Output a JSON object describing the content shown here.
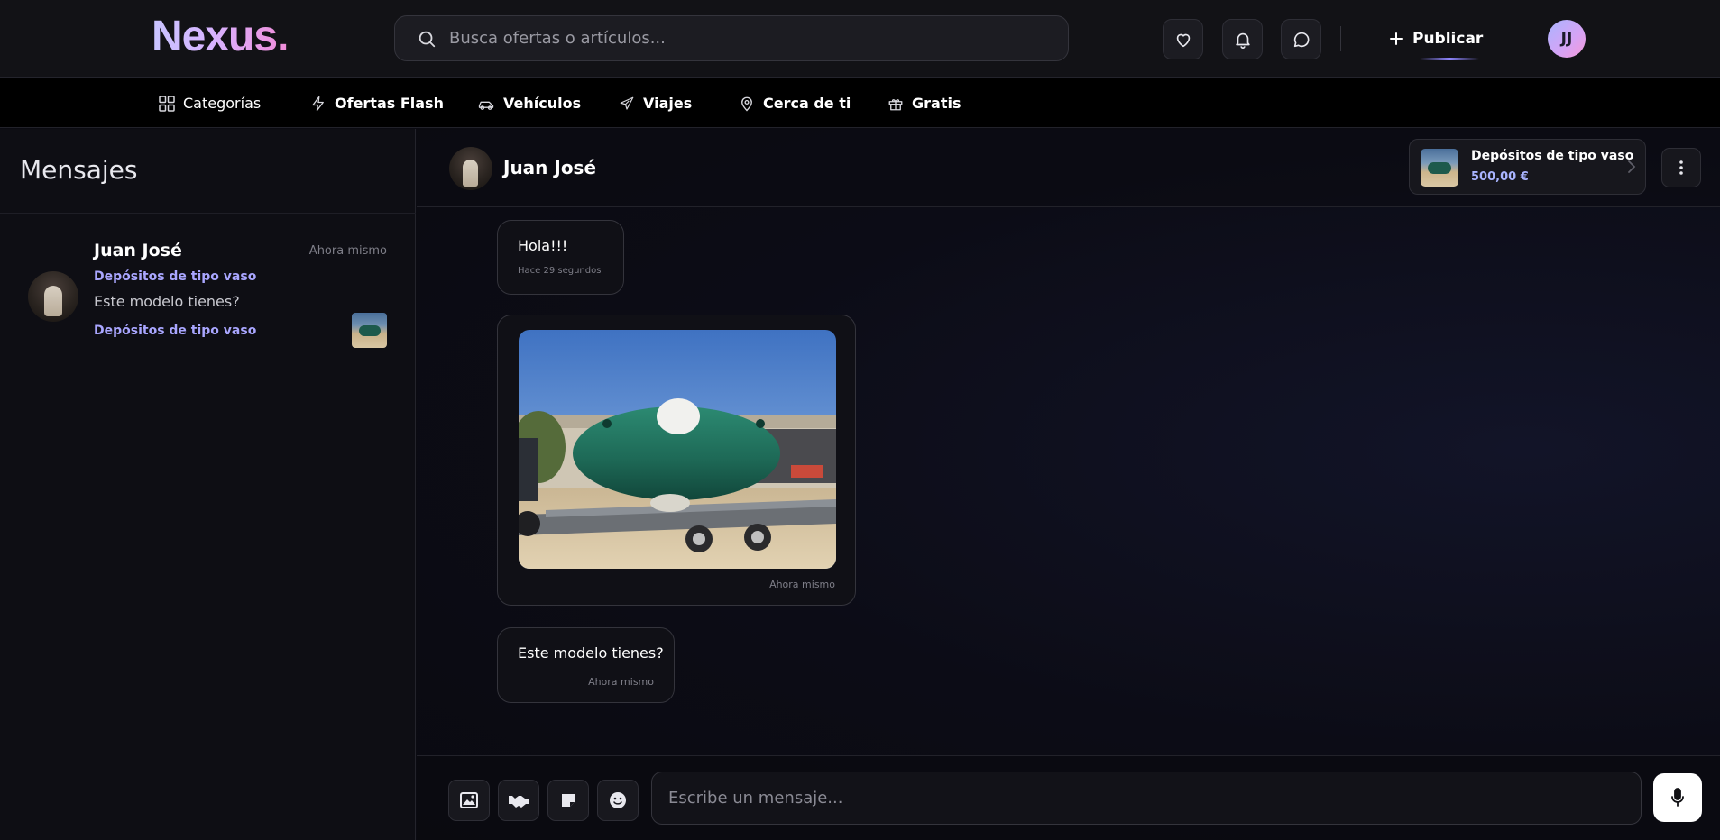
{
  "header": {
    "logo": "Nexus.",
    "search_placeholder": "Busca ofertas o artículos...",
    "icons": [
      "heart-icon",
      "bell-icon",
      "chat-bubble-icon"
    ],
    "publish_label": "Publicar",
    "user_initials": "JJ"
  },
  "categories": [
    {
      "label": "Categorías",
      "icon": "grid-icon"
    },
    {
      "label": "Ofertas Flash",
      "icon": "lightning-icon"
    },
    {
      "label": "Vehículos",
      "icon": "car-icon"
    },
    {
      "label": "Viajes",
      "icon": "plane-icon"
    },
    {
      "label": "Cerca de ti",
      "icon": "location-pin-icon"
    },
    {
      "label": "Gratis",
      "icon": "gift-icon"
    }
  ],
  "sidebar": {
    "title": "Mensajes",
    "conversations": [
      {
        "name": "Juan José",
        "time": "Ahora mismo",
        "item": "Depósitos de tipo vaso",
        "last_message": "Este modelo tienes?",
        "item_repeat": "Depósitos de tipo vaso"
      }
    ]
  },
  "chat": {
    "contact_name": "Juan José",
    "product": {
      "title": "Depósitos de tipo vaso",
      "price": "500,00 €"
    },
    "messages": [
      {
        "type": "text",
        "text": "Hola!!!",
        "time": "Hace 29 segundos"
      },
      {
        "type": "image",
        "time": "Ahora mismo"
      },
      {
        "type": "text",
        "text": "Este modelo tienes?",
        "time": "Ahora mismo"
      }
    ],
    "composer": {
      "placeholder": "Escribe un mensaje...",
      "buttons": [
        "image-icon",
        "handshake-icon",
        "sticker-icon",
        "emoji-icon"
      ],
      "send_icon": "microphone-icon"
    }
  },
  "colors": {
    "accent": "#a9a6ff",
    "price": "#a9b4ff",
    "background": "#0b0b12",
    "logo_gradient": [
      "#c8c4ff",
      "#f08cd8"
    ]
  }
}
